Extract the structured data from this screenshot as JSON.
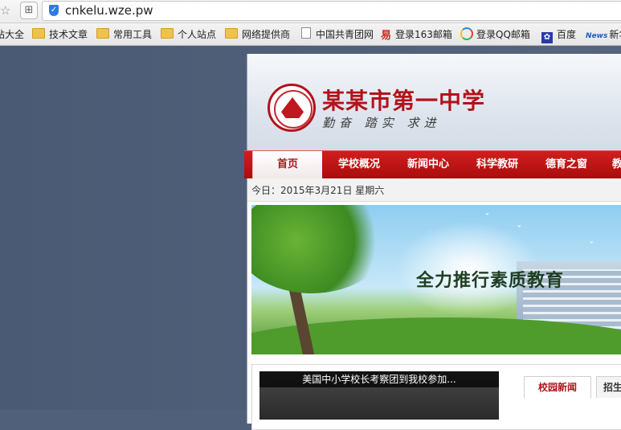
{
  "browser": {
    "url": "cnkelu.wze.pw",
    "bookmarks": [
      {
        "label": "站大全",
        "icon": "folder-icon"
      },
      {
        "label": "技术文章",
        "icon": "folder-icon"
      },
      {
        "label": "常用工具",
        "icon": "folder-icon"
      },
      {
        "label": "个人站点",
        "icon": "folder-icon"
      },
      {
        "label": "网络提供商",
        "icon": "folder-icon"
      },
      {
        "label": "中国共青团网",
        "icon": "page-icon"
      },
      {
        "label": "登录163邮箱",
        "icon": "netease-icon"
      },
      {
        "label": "登录QQ邮箱",
        "icon": "qq-icon"
      },
      {
        "label": "百度",
        "icon": "baidu-icon"
      },
      {
        "label": "新华",
        "icon": "news-icon",
        "icon_text": "News"
      }
    ]
  },
  "site": {
    "school_name": "某某市第一中学",
    "motto": "勤奋 踏实 求进",
    "nav": [
      "首页",
      "学校概况",
      "新闻中心",
      "科学教研",
      "德育之窗",
      "教"
    ],
    "date_text": "今日：2015年3月21日 星期六",
    "banner_slogan": "全力推行素质教育",
    "news_caption": "美国中小学校长考察团到我校参加...",
    "tabs": [
      "校园新闻",
      "招生"
    ]
  },
  "colors": {
    "brand_red": "#b3121b",
    "nav_red": "#c41a1a"
  }
}
